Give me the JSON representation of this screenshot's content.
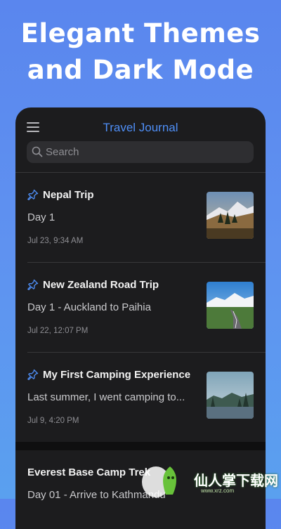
{
  "promo": {
    "line1": "Elegant Themes",
    "line2": "and Dark Mode"
  },
  "app": {
    "title": "Travel Journal",
    "accent": "#4f8ff7",
    "menu_icon": "hamburger-menu-icon",
    "pin_icon": "pin-icon"
  },
  "search": {
    "placeholder": "Search"
  },
  "entries": [
    {
      "title": "Nepal Trip",
      "preview": "Day 1",
      "date": "Jul 23, 9:34 AM",
      "pinned": true,
      "thumb": "mountain-forest-photo"
    },
    {
      "title": "New Zealand Road Trip",
      "preview": "Day 1 - Auckland to Paihia",
      "date": "Jul 22, 12:07 PM",
      "pinned": true,
      "thumb": "mountain-road-photo"
    },
    {
      "title": "My First Camping Experience",
      "preview": "Last summer, I went camping to...",
      "date": "Jul 9, 4:20 PM",
      "pinned": true,
      "thumb": "lake-forest-photo"
    },
    {
      "title": "Everest Base Camp Trek",
      "preview": "Day 01 - Arrive to Kathmandu",
      "date": "",
      "pinned": false,
      "thumb": ""
    }
  ],
  "watermark": {
    "text": "仙人掌下载网",
    "sub": "www.xrz.com"
  }
}
